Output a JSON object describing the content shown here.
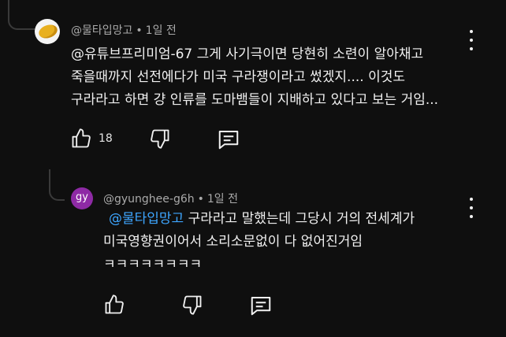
{
  "comment": {
    "author": "@물타입망고",
    "time": "1일 전",
    "lines": [
      "@유튜브프리미엄-67  그게 사기극이면 당현히 소련이 알아채고",
      "죽을때까지 선전에다가 미국 구라쟁이라고 썼겠지.... 이것도",
      "구라라고 하면 걍 인류를 도마뱀들이 지배하고 있다고 보는 거임..."
    ],
    "like_count": "18"
  },
  "reply": {
    "avatar_initials": "gy",
    "author": "@gyunghee-g6h",
    "time": "1일 전",
    "mention": "@물타입망고",
    "line1_rest": "  구라라고 말했는데 그당시 거의 전세계가",
    "line2": "미국영향권이어서 소리소문없이 다 없어진거임",
    "line3": "ㅋㅋㅋㅋㅋㅋㅋㅋ"
  },
  "separator": "•",
  "icons": {
    "like": "thumbs-up-icon",
    "dislike": "thumbs-down-icon",
    "reply": "comment-icon",
    "more": "more-vertical-icon"
  },
  "colors": {
    "background": "#0f0f0f",
    "text": "#f1f1f1",
    "meta": "#aaaaaa",
    "mention": "#3ea6ff",
    "reply_avatar": "#8e2aa5"
  }
}
